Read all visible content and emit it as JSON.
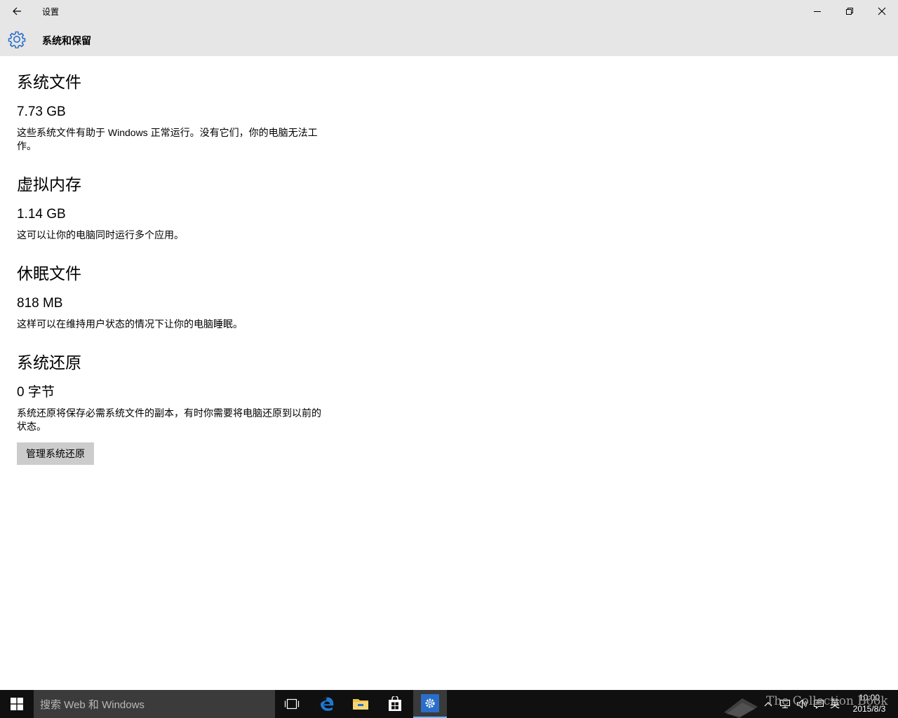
{
  "window": {
    "app_title": "设置",
    "back_icon": "arrow-left-icon",
    "minimize_icon": "minimize-icon",
    "maximize_icon": "restore-icon",
    "close_icon": "close-icon"
  },
  "header": {
    "icon": "gear-icon",
    "title": "系统和保留",
    "accent_color": "#2a6ec9"
  },
  "sections": [
    {
      "title": "系统文件",
      "size": "7.73 GB",
      "description": "这些系统文件有助于 Windows 正常运行。没有它们，你的电脑无法工作。"
    },
    {
      "title": "虚拟内存",
      "size": "1.14 GB",
      "description": "这可以让你的电脑同时运行多个应用。"
    },
    {
      "title": "休眠文件",
      "size": "818 MB",
      "description": "这样可以在维持用户状态的情况下让你的电脑睡眠。"
    },
    {
      "title": "系统还原",
      "size": "0 字节",
      "description": "系统还原将保存必需系统文件的副本，有时你需要将电脑还原到以前的状态。",
      "button_label": "管理系统还原"
    }
  ],
  "taskbar": {
    "search_placeholder": "搜索 Web 和 Windows",
    "apps": [
      "task-view-icon",
      "edge-icon",
      "file-explorer-icon",
      "store-icon",
      "settings-icon"
    ],
    "tray": {
      "ime": "英",
      "time": "10:00",
      "date": "2015/8/3"
    },
    "watermark": "The Collection Book"
  }
}
